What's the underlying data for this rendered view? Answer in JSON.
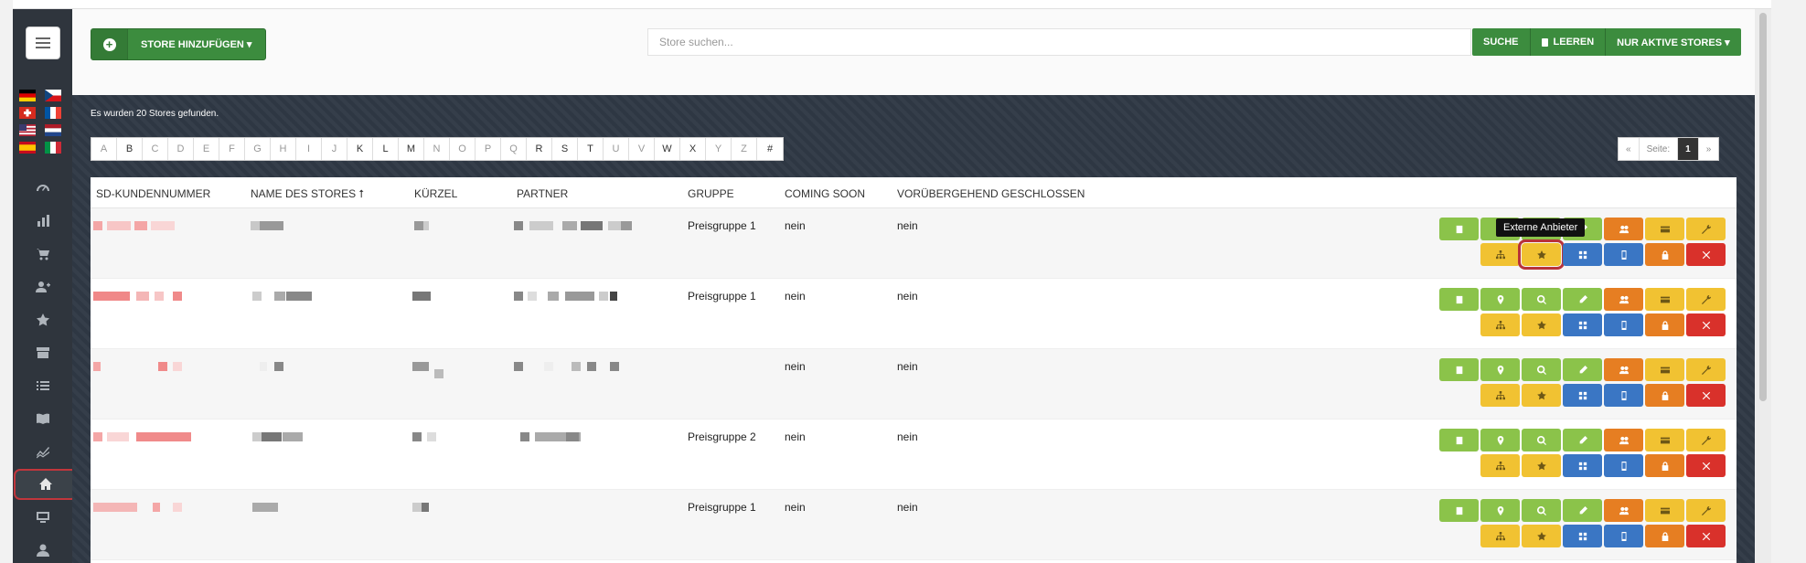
{
  "header": {
    "add_store_label": "STORE HINZUFÜGEN ▾",
    "search_placeholder": "Store suchen...",
    "search_button": "SUCHE",
    "clear_button": "LEEREN",
    "filter_button": "NUR AKTIVE STORES ▾"
  },
  "results_text": "Es wurden 20 Stores gefunden.",
  "alphabet": [
    {
      "l": "A",
      "on": false
    },
    {
      "l": "B",
      "on": true
    },
    {
      "l": "C",
      "on": false
    },
    {
      "l": "D",
      "on": false
    },
    {
      "l": "E",
      "on": false
    },
    {
      "l": "F",
      "on": false
    },
    {
      "l": "G",
      "on": false
    },
    {
      "l": "H",
      "on": false
    },
    {
      "l": "I",
      "on": false
    },
    {
      "l": "J",
      "on": false
    },
    {
      "l": "K",
      "on": true
    },
    {
      "l": "L",
      "on": true
    },
    {
      "l": "M",
      "on": true
    },
    {
      "l": "N",
      "on": false
    },
    {
      "l": "O",
      "on": false
    },
    {
      "l": "P",
      "on": false
    },
    {
      "l": "Q",
      "on": false
    },
    {
      "l": "R",
      "on": true
    },
    {
      "l": "S",
      "on": true
    },
    {
      "l": "T",
      "on": true
    },
    {
      "l": "U",
      "on": false
    },
    {
      "l": "V",
      "on": false
    },
    {
      "l": "W",
      "on": true
    },
    {
      "l": "X",
      "on": true
    },
    {
      "l": "Y",
      "on": false
    },
    {
      "l": "Z",
      "on": false
    },
    {
      "l": "#",
      "on": true
    }
  ],
  "pager": {
    "prev": "«",
    "label": "Seite:",
    "page": "1",
    "next": "»"
  },
  "columns": [
    "SD-KUNDENNUMMER",
    "NAME DES STORES ⭡",
    "KÜRZEL",
    "PARTNER",
    "GRUPPE",
    "COMING SOON",
    "VORÜBERGEHEND GESCHLOSSEN"
  ],
  "rows": [
    {
      "gruppe": "Preisgruppe 1",
      "coming_soon": "nein",
      "geschlossen": "nein"
    },
    {
      "gruppe": "Preisgruppe 1",
      "coming_soon": "nein",
      "geschlossen": "nein"
    },
    {
      "gruppe": "",
      "coming_soon": "nein",
      "geschlossen": "nein"
    },
    {
      "gruppe": "Preisgruppe 2",
      "coming_soon": "nein",
      "geschlossen": "nein"
    },
    {
      "gruppe": "Preisgruppe 1",
      "coming_soon": "nein",
      "geschlossen": "nein"
    }
  ],
  "tooltip": "Externe Anbieter",
  "sidebar_icons": [
    "dashboard-icon",
    "bar-chart-icon",
    "cart-icon",
    "user-plus-icon",
    "star-icon",
    "archive-icon",
    "list-icon",
    "book-icon",
    "line-chart-icon",
    "home-icon",
    "monitor-icon",
    "user-icon"
  ],
  "colors": {
    "primary_green": "#3c8c3e",
    "lime": "#8bc34a",
    "orange": "#e67e22",
    "yellow": "#f1c232",
    "blue": "#3a76c4",
    "red": "#d9312b",
    "highlight": "#b8323a"
  }
}
